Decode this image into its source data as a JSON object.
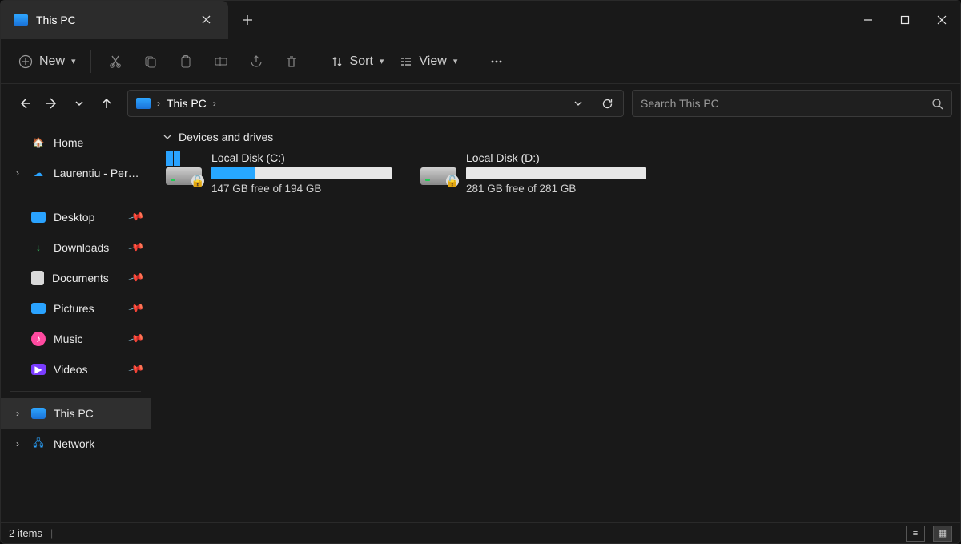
{
  "tab": {
    "title": "This PC"
  },
  "toolbar": {
    "new_label": "New",
    "sort_label": "Sort",
    "view_label": "View"
  },
  "address": {
    "location": "This PC"
  },
  "search": {
    "placeholder": "Search This PC"
  },
  "sidebar": {
    "home": "Home",
    "onedrive": "Laurentiu - Personal",
    "quick": [
      {
        "label": "Desktop"
      },
      {
        "label": "Downloads"
      },
      {
        "label": "Documents"
      },
      {
        "label": "Pictures"
      },
      {
        "label": "Music"
      },
      {
        "label": "Videos"
      }
    ],
    "thispc": "This PC",
    "network": "Network"
  },
  "content": {
    "group_label": "Devices and drives",
    "drives": [
      {
        "name": "Local Disk (C:)",
        "free_text": "147 GB free of 194 GB",
        "fill_pct": 24,
        "has_win_badge": true
      },
      {
        "name": "Local Disk (D:)",
        "free_text": "281 GB free of 281 GB",
        "fill_pct": 0,
        "has_win_badge": false
      }
    ]
  },
  "status": {
    "items": "2 items"
  }
}
